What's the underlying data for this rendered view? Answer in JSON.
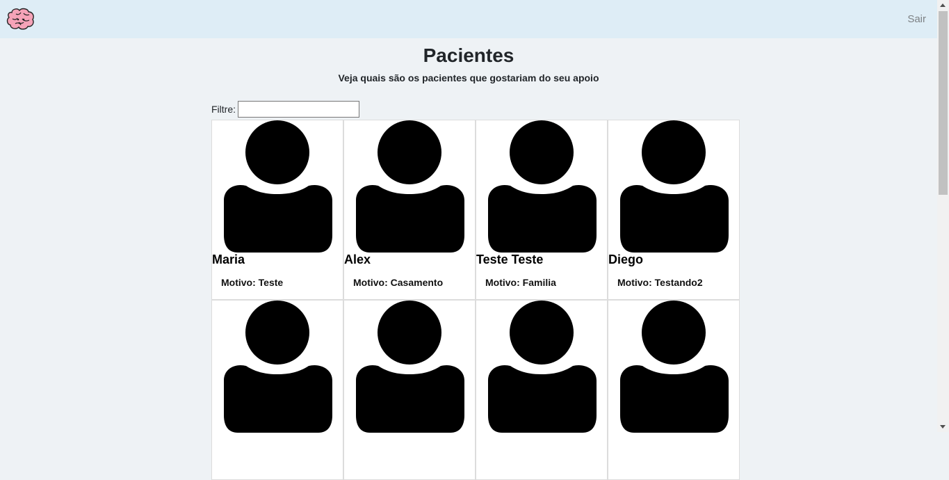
{
  "nav": {
    "logo_icon": "brain-icon",
    "logout_label": "Sair"
  },
  "page": {
    "title": "Pacientes",
    "subtitle": "Veja quais são os pacientes que gostariam do seu apoio"
  },
  "filter": {
    "label": "Filtre:",
    "value": ""
  },
  "patients": [
    {
      "name": "Maria",
      "reason": "Motivo: Teste"
    },
    {
      "name": "Alex",
      "reason": "Motivo: Casamento"
    },
    {
      "name": "Teste Teste",
      "reason": "Motivo: Familia"
    },
    {
      "name": "Diego",
      "reason": "Motivo: Testando2"
    },
    {
      "name": "",
      "reason": ""
    },
    {
      "name": "",
      "reason": ""
    },
    {
      "name": "",
      "reason": ""
    },
    {
      "name": "",
      "reason": ""
    }
  ],
  "colors": {
    "navbar": "#deedf6",
    "background": "#eef2f5",
    "logo_pink": "#f5a3b8"
  }
}
